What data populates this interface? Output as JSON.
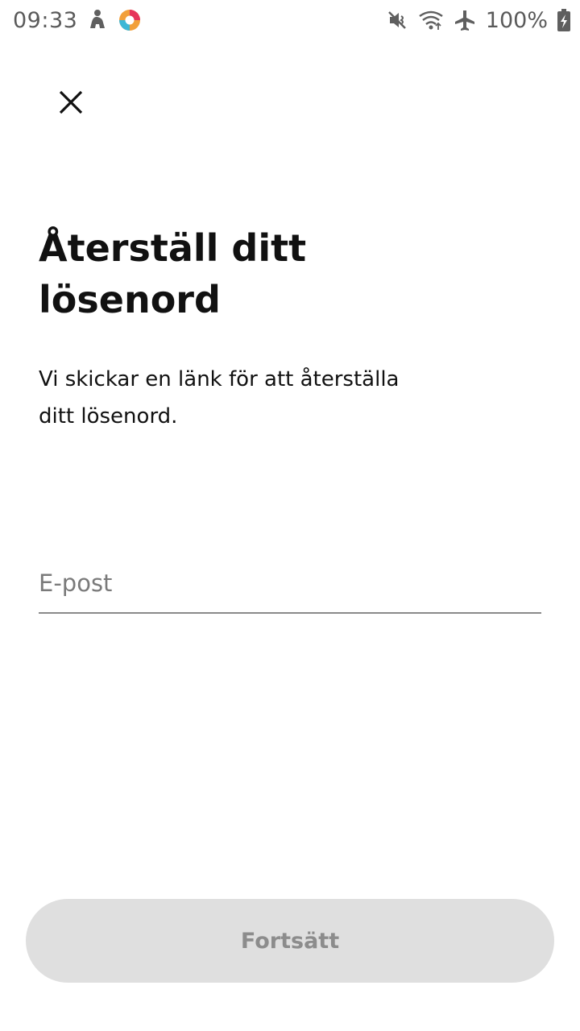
{
  "status_bar": {
    "time": "09:33",
    "battery": "100%",
    "icons": [
      "notification-figure-icon",
      "app-logo-icon",
      "vibrate-mute-icon",
      "wifi-icon",
      "airplane-mode-icon",
      "battery-charging-icon"
    ]
  },
  "header": {
    "close_icon": "close-icon"
  },
  "main": {
    "title": "Återställ ditt lösenord",
    "description": "Vi skickar en länk för att återställa ditt lösenord.",
    "email_placeholder": "E-post",
    "email_value": ""
  },
  "footer": {
    "continue_label": "Fortsätt",
    "continue_enabled": false
  },
  "colors": {
    "button_bg_disabled": "#dfdfdf",
    "button_text_disabled": "#8c8c8c",
    "text_primary": "#111111",
    "underline": "#8a8a8a"
  }
}
